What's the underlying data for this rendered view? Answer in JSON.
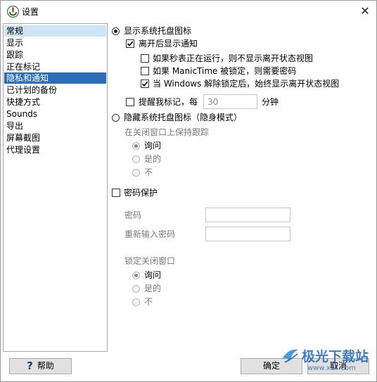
{
  "window": {
    "title": "设置",
    "close_glyph": "✕"
  },
  "sidebar": {
    "items": [
      {
        "label": "常规"
      },
      {
        "label": "显示"
      },
      {
        "label": "跟踪"
      },
      {
        "label": "正在标记"
      },
      {
        "label": "隐私和通知"
      },
      {
        "label": "已计划的备份"
      },
      {
        "label": "快捷方式"
      },
      {
        "label": "Sounds"
      },
      {
        "label": "导出"
      },
      {
        "label": "屏幕截图"
      },
      {
        "label": "代理设置"
      }
    ],
    "selected": "隐私和通知",
    "hover": "常规"
  },
  "tray": {
    "show_label": "显示系统托盘图标",
    "show_selected": true,
    "notify_on_leave": {
      "label": "离开后显示通知",
      "checked": true
    },
    "no_leave_view_when_stopwatch": {
      "label": "如果秒表正在运行，则不显示离开状态视图",
      "checked": false
    },
    "require_password_locked": {
      "label": "如果 ManicTime 被锁定，则需要密码",
      "checked": false
    },
    "always_show_leave_view": {
      "label": "当 Windows 解除锁定后，始终显示离开状态视图",
      "checked": true
    },
    "remind_tag": {
      "label": "提醒我标记，每",
      "checked": false,
      "value": "30",
      "unit": "分钟"
    },
    "hide_label": "隐藏系统托盘图标（隐身模式）",
    "hide_selected": false
  },
  "keep_tracking": {
    "title": "在关闭窗口上保持跟踪",
    "options": [
      "询问",
      "是的",
      "不"
    ],
    "selected": "询问"
  },
  "password": {
    "label": "密码保护",
    "checked": false,
    "password_label": "密码",
    "password_value": "",
    "reenter_label": "重新输入密码",
    "reenter_value": ""
  },
  "lock_close": {
    "title": "锁定关闭窗口",
    "options": [
      "询问",
      "是的",
      "不"
    ],
    "selected": "询问"
  },
  "footer": {
    "help_label": "帮助",
    "help_glyph": "?",
    "ok_label": "确定",
    "cancel_label": "取消"
  },
  "colors": {
    "selection": "#2b6fb8",
    "hover": "#cce4f7",
    "check": "#000000"
  },
  "icons": {
    "app": "manictime-logo-icon",
    "help": "help-question-icon",
    "close": "close-icon",
    "check": "checkmark-icon"
  },
  "watermark": {
    "text": "极光下载站",
    "url": "www.xz7.com"
  }
}
